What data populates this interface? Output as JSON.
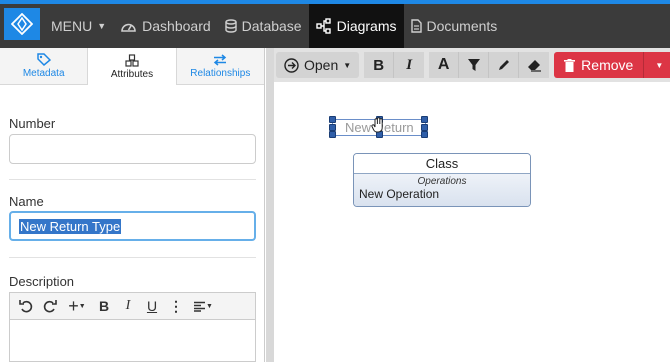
{
  "nav": {
    "menu_label": "MENU",
    "items": [
      {
        "label": "Dashboard",
        "icon": "gauge-icon"
      },
      {
        "label": "Database",
        "icon": "database-icon"
      },
      {
        "label": "Diagrams",
        "icon": "diagram-icon"
      },
      {
        "label": "Documents",
        "icon": "document-icon"
      }
    ],
    "active": "Diagrams"
  },
  "left_tabs": [
    {
      "label": "Metadata",
      "icon": "tag-icon"
    },
    {
      "label": "Attributes",
      "icon": "cubes-icon"
    },
    {
      "label": "Relationships",
      "icon": "exchange-icon"
    }
  ],
  "form": {
    "number_label": "Number",
    "number_value": "",
    "name_label": "Name",
    "name_value": "New Return Type",
    "description_label": "Description"
  },
  "toolbar": {
    "open_label": "Open",
    "remove_label": "Remove"
  },
  "diagram": {
    "return_text": "New Return",
    "class_title": "Class",
    "operations_label": "Operations",
    "operations": [
      "New Operation"
    ]
  },
  "colors": {
    "accent": "#1e88e5",
    "topbar": "#3b3b3b",
    "remove": "#dc3545",
    "selection": "#3476c9"
  }
}
